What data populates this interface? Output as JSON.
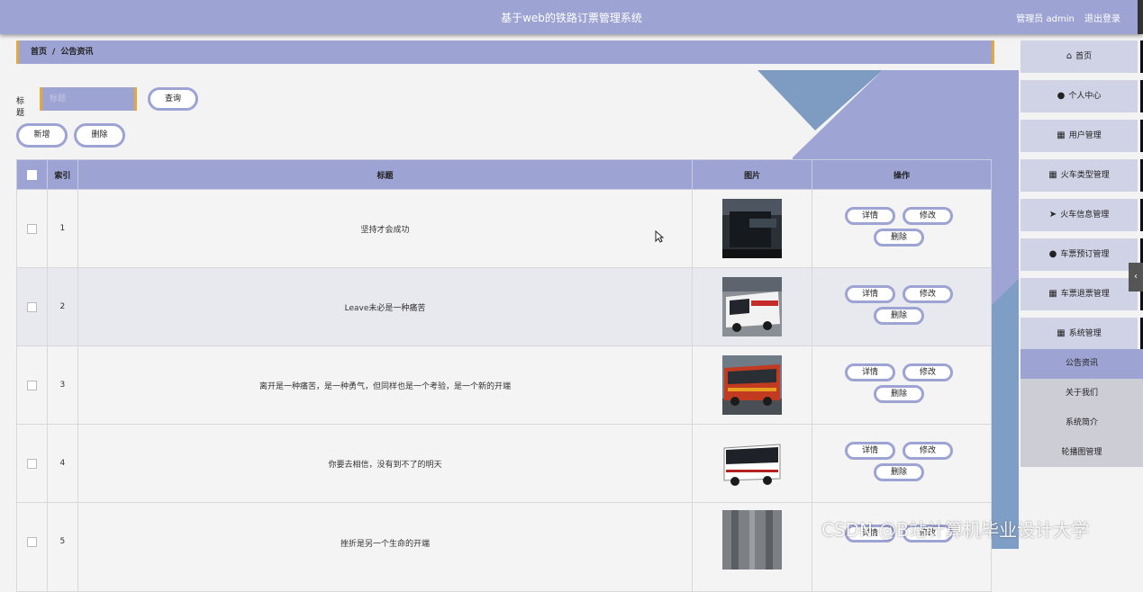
{
  "header": {
    "title": "基于web的铁路订票管理系统",
    "user_role": "管理员 admin",
    "logout": "退出登录"
  },
  "breadcrumb": {
    "home": "首页",
    "separator": "/",
    "current": "公告资讯"
  },
  "search": {
    "label": "标题",
    "placeholder": "标题",
    "button": "查询"
  },
  "actions": {
    "add": "新增",
    "delete": "删除"
  },
  "table": {
    "headers": {
      "index": "索引",
      "title": "标题",
      "image": "图片",
      "ops": "操作"
    },
    "rows": [
      {
        "index": "1",
        "title": "坚持才会成功"
      },
      {
        "index": "2",
        "title": "Leave未必是一种痛苦"
      },
      {
        "index": "3",
        "title": "离开是一种痛苦，是一种勇气，但同样也是一个考验，是一个新的开端"
      },
      {
        "index": "4",
        "title": "你要去相信，没有到不了的明天"
      },
      {
        "index": "5",
        "title": "挫折是另一个生命的开端"
      }
    ],
    "row_buttons": {
      "detail": "详情",
      "edit": "修改",
      "delete": "删除"
    }
  },
  "sidebar": {
    "items": [
      {
        "label": "首页",
        "icon": "home-icon"
      },
      {
        "label": "个人中心",
        "icon": "user-icon"
      },
      {
        "label": "用户管理",
        "icon": "grid-icon"
      },
      {
        "label": "火车类型管理",
        "icon": "grid-icon"
      },
      {
        "label": "火车信息管理",
        "icon": "send-icon"
      },
      {
        "label": "车票预订管理",
        "icon": "user-icon"
      },
      {
        "label": "车票退票管理",
        "icon": "grid-icon"
      },
      {
        "label": "系统管理",
        "icon": "grid-icon"
      }
    ],
    "subitems": [
      {
        "label": "公告资讯",
        "active": true
      },
      {
        "label": "关于我们"
      },
      {
        "label": "系统简介"
      },
      {
        "label": "轮播图管理"
      }
    ]
  },
  "watermark": "CSDN @B站计算机毕业设计大学",
  "colors": {
    "accent": "#9da3d2",
    "border_accent": "#e3a93a"
  }
}
